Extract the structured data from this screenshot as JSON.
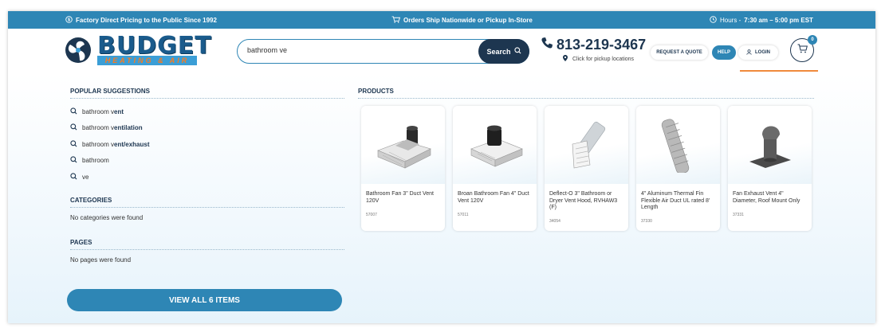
{
  "topbar": {
    "left": "Factory Direct Pricing to the Public Since 1992",
    "center": "Orders Ship Nationwide or Pickup In-Store",
    "right_label": "Hours - ",
    "right_hours": "7:30 am – 5:00 pm EST"
  },
  "logo": {
    "name": "BUDGET",
    "tagline": "HEATING & AIR"
  },
  "search": {
    "value": "bathroom ve",
    "button_label": "Search"
  },
  "contact": {
    "phone": "813-219-3467",
    "pickup": "Click for pickup locations"
  },
  "nav": {
    "quote": "REQUEST A QUOTE",
    "help": "HELP",
    "login": "LOGIN",
    "cart_count": "0"
  },
  "suggestions": {
    "title": "POPULAR SUGGESTIONS",
    "items": [
      {
        "prefix": "bathroom v",
        "suffix": "ent"
      },
      {
        "prefix": "bathroom v",
        "suffix": "entilation"
      },
      {
        "prefix": "bathroom v",
        "suffix": "ent/exhaust"
      },
      {
        "prefix": "bathroom",
        "suffix": ""
      },
      {
        "prefix": "ve",
        "suffix": ""
      }
    ]
  },
  "categories": {
    "title": "CATEGORIES",
    "empty": "No categories were found"
  },
  "pages": {
    "title": "PAGES",
    "empty": "No pages were found"
  },
  "view_all": "VIEW ALL 6 ITEMS",
  "products": {
    "title": "PRODUCTS",
    "items": [
      {
        "name": "Bathroom Fan 3\" Duct Vent 120V",
        "sku": "57007",
        "icon": "bathroom-fan-icon"
      },
      {
        "name": "Broan Bathroom Fan 4\" Duct Vent 120V",
        "sku": "57011",
        "icon": "broan-fan-icon"
      },
      {
        "name": "Deflect-O 3\" Bathroom or Dryer Vent Hood, RVHAW3 (F)",
        "sku": "34054",
        "icon": "vent-hood-icon"
      },
      {
        "name": "4\" Aluminum Thermal Fin Flexible Air Duct UL rated 8' Length",
        "sku": "37330",
        "icon": "flex-duct-icon"
      },
      {
        "name": "Fan Exhaust Vent 4\" Diameter, Roof Mount Only",
        "sku": "37331",
        "icon": "roof-vent-icon"
      }
    ]
  },
  "colors": {
    "brand_blue": "#2e86b5",
    "navy": "#1d3650",
    "accent_orange": "#f08a3c"
  }
}
